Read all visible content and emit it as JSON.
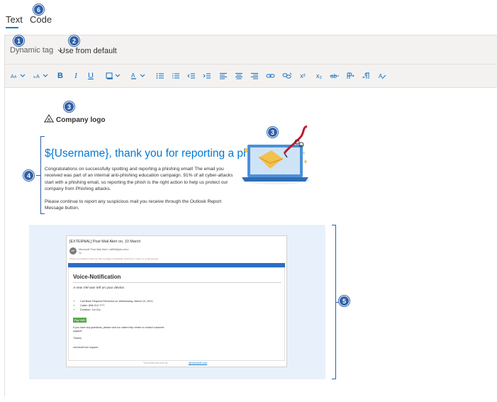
{
  "tabs": [
    {
      "label": "Text"
    },
    {
      "label": "Code"
    }
  ],
  "callouts": {
    "c1": "1",
    "c2": "2",
    "c3": "3",
    "c4": "4",
    "c5": "5",
    "c6": "6"
  },
  "tagbar": {
    "dynamic_tag": "Dynamic tag",
    "use_default": "Use from default"
  },
  "toolbar": {
    "bold": "B",
    "italic": "I",
    "underline": "U",
    "superscript": "x²",
    "subscript": "x₂",
    "icons": [
      "font-icon",
      "font-size-icon",
      "bold-icon",
      "italic-icon",
      "underline-icon",
      "highlight-icon",
      "font-color-icon",
      "bullet-list-icon",
      "numbered-list-icon",
      "decrease-indent-icon",
      "increase-indent-icon",
      "align-left-icon",
      "align-center-icon",
      "align-right-icon",
      "insert-link-icon",
      "remove-link-icon",
      "superscript-icon",
      "subscript-icon",
      "strikethrough-icon",
      "ltr-icon",
      "rtl-icon",
      "clear-format-icon"
    ]
  },
  "content": {
    "logo_text": "Company logo",
    "headline": "${Username}, thank you for reporting a phish!",
    "paragraph1": "Congratulations on successfully spotting and reporting a phishing email! The email you received was part of an internal anti-phishing education campaign. 91% of all cyber-attacks start with a phishing email, so reporting the phish is the right action to help us protect our company from Phishing attacks.",
    "paragraph2": "Please continue to report any suspicious mail you receive through the Outlook Report Message button."
  },
  "email_preview": {
    "subject": "[EXTERNAL] Post Mail Alert on, 10 March",
    "avatar_initials": "MP",
    "from": "Microsoft Post Mail Alert <alt00@pfu.edu>",
    "to": "To",
    "note": "If there are problems with how this message is displayed, click here to view it in a web browser.",
    "title": "Voice-Notification",
    "subtitle": "A new VM was left on your device.",
    "details": [
      "Call Back Request Received on Wednesday, March 10, 2021.",
      "Caller: 808-212-7**7",
      "Duration: 1m 11s"
    ],
    "play_button": "Play VMS",
    "question": "If you have any questions, please visit our online help center or contact customer support.",
    "thanks": "Thanks,",
    "signature": "microsoft.com support",
    "footer_text": "This email was sent by",
    "footer_link": "@microsoft.com"
  },
  "colors": {
    "accent": "#0078d4",
    "callout": "#2f5fa7",
    "preview_bg": "#e8f1fb"
  }
}
